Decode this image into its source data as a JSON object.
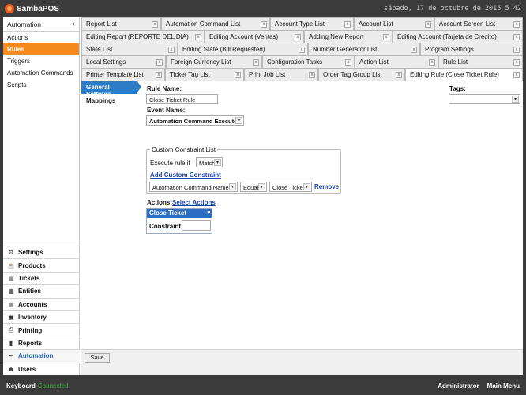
{
  "app": {
    "title": "SambaPOS",
    "datetime": "sábado, 17 de octubre de 2015 5 42"
  },
  "sidebar": {
    "header": "Automation",
    "items": [
      {
        "label": "Actions",
        "active": false
      },
      {
        "label": "Rules",
        "active": true
      },
      {
        "label": "Triggers",
        "active": false
      },
      {
        "label": "Automation Commands",
        "active": false
      },
      {
        "label": "Scripts",
        "active": false
      }
    ],
    "modules": [
      {
        "label": "Settings",
        "icon": "gear-icon"
      },
      {
        "label": "Products",
        "icon": "products-icon"
      },
      {
        "label": "Tickets",
        "icon": "tickets-icon"
      },
      {
        "label": "Entities",
        "icon": "entities-icon"
      },
      {
        "label": "Accounts",
        "icon": "accounts-icon"
      },
      {
        "label": "Inventory",
        "icon": "inventory-icon"
      },
      {
        "label": "Printing",
        "icon": "printer-icon"
      },
      {
        "label": "Reports",
        "icon": "bar-chart-icon"
      },
      {
        "label": "Automation",
        "icon": "wand-icon",
        "active": true
      },
      {
        "label": "Users",
        "icon": "user-icon"
      }
    ]
  },
  "tabs": {
    "rows": [
      [
        "Report List",
        "Automation Command List",
        "Account Type List",
        "Account List",
        "Account Screen List"
      ],
      [
        "Editing Report (REPORTE DEL DIA)",
        "Editing Account (Ventas)",
        "Adding New Report",
        "Editing Account (Tarjeta de Credito)"
      ],
      [
        "State List",
        "Editing State (Bill Requested)",
        "Number Generator List",
        "Program Settings"
      ],
      [
        "Local Settings",
        "Foreign Currency List",
        "Configuration Tasks",
        "Action List",
        "Rule List"
      ],
      [
        "Printer Template List",
        "Ticket Tag List",
        "Print Job List",
        "Order Tag Group List",
        "Editing Rule (Close Ticket Rule)"
      ]
    ]
  },
  "editor": {
    "subnav": [
      "General Settings",
      "Mappings"
    ],
    "rule_name_label": "Rule Name:",
    "rule_name_value": "Close Ticket Rule",
    "tags_label": "Tags:",
    "tags_value": "",
    "event_name_label": "Event Name:",
    "event_name_value": "Automation Command Executed",
    "constraint_group_title": "Custom Constraint List",
    "execute_rule_if_label": "Execute rule if",
    "execute_rule_if_value": "Matches",
    "add_constraint_link": "Add Custom Constraint",
    "constraint_field": "Automation Command Name",
    "constraint_operator": "Equals",
    "constraint_value": "Close Ticket",
    "remove_link": "Remove",
    "actions_label": "Actions:",
    "select_actions_link": "Select Actions",
    "action_name": "Close Ticket",
    "action_constraint_label": "Constraint:",
    "action_constraint_value": "",
    "save_label": "Save"
  },
  "status": {
    "keyboard_label": "Keyboard",
    "connection_status": "Connected",
    "user": "Administrator",
    "main_menu": "Main Menu"
  }
}
